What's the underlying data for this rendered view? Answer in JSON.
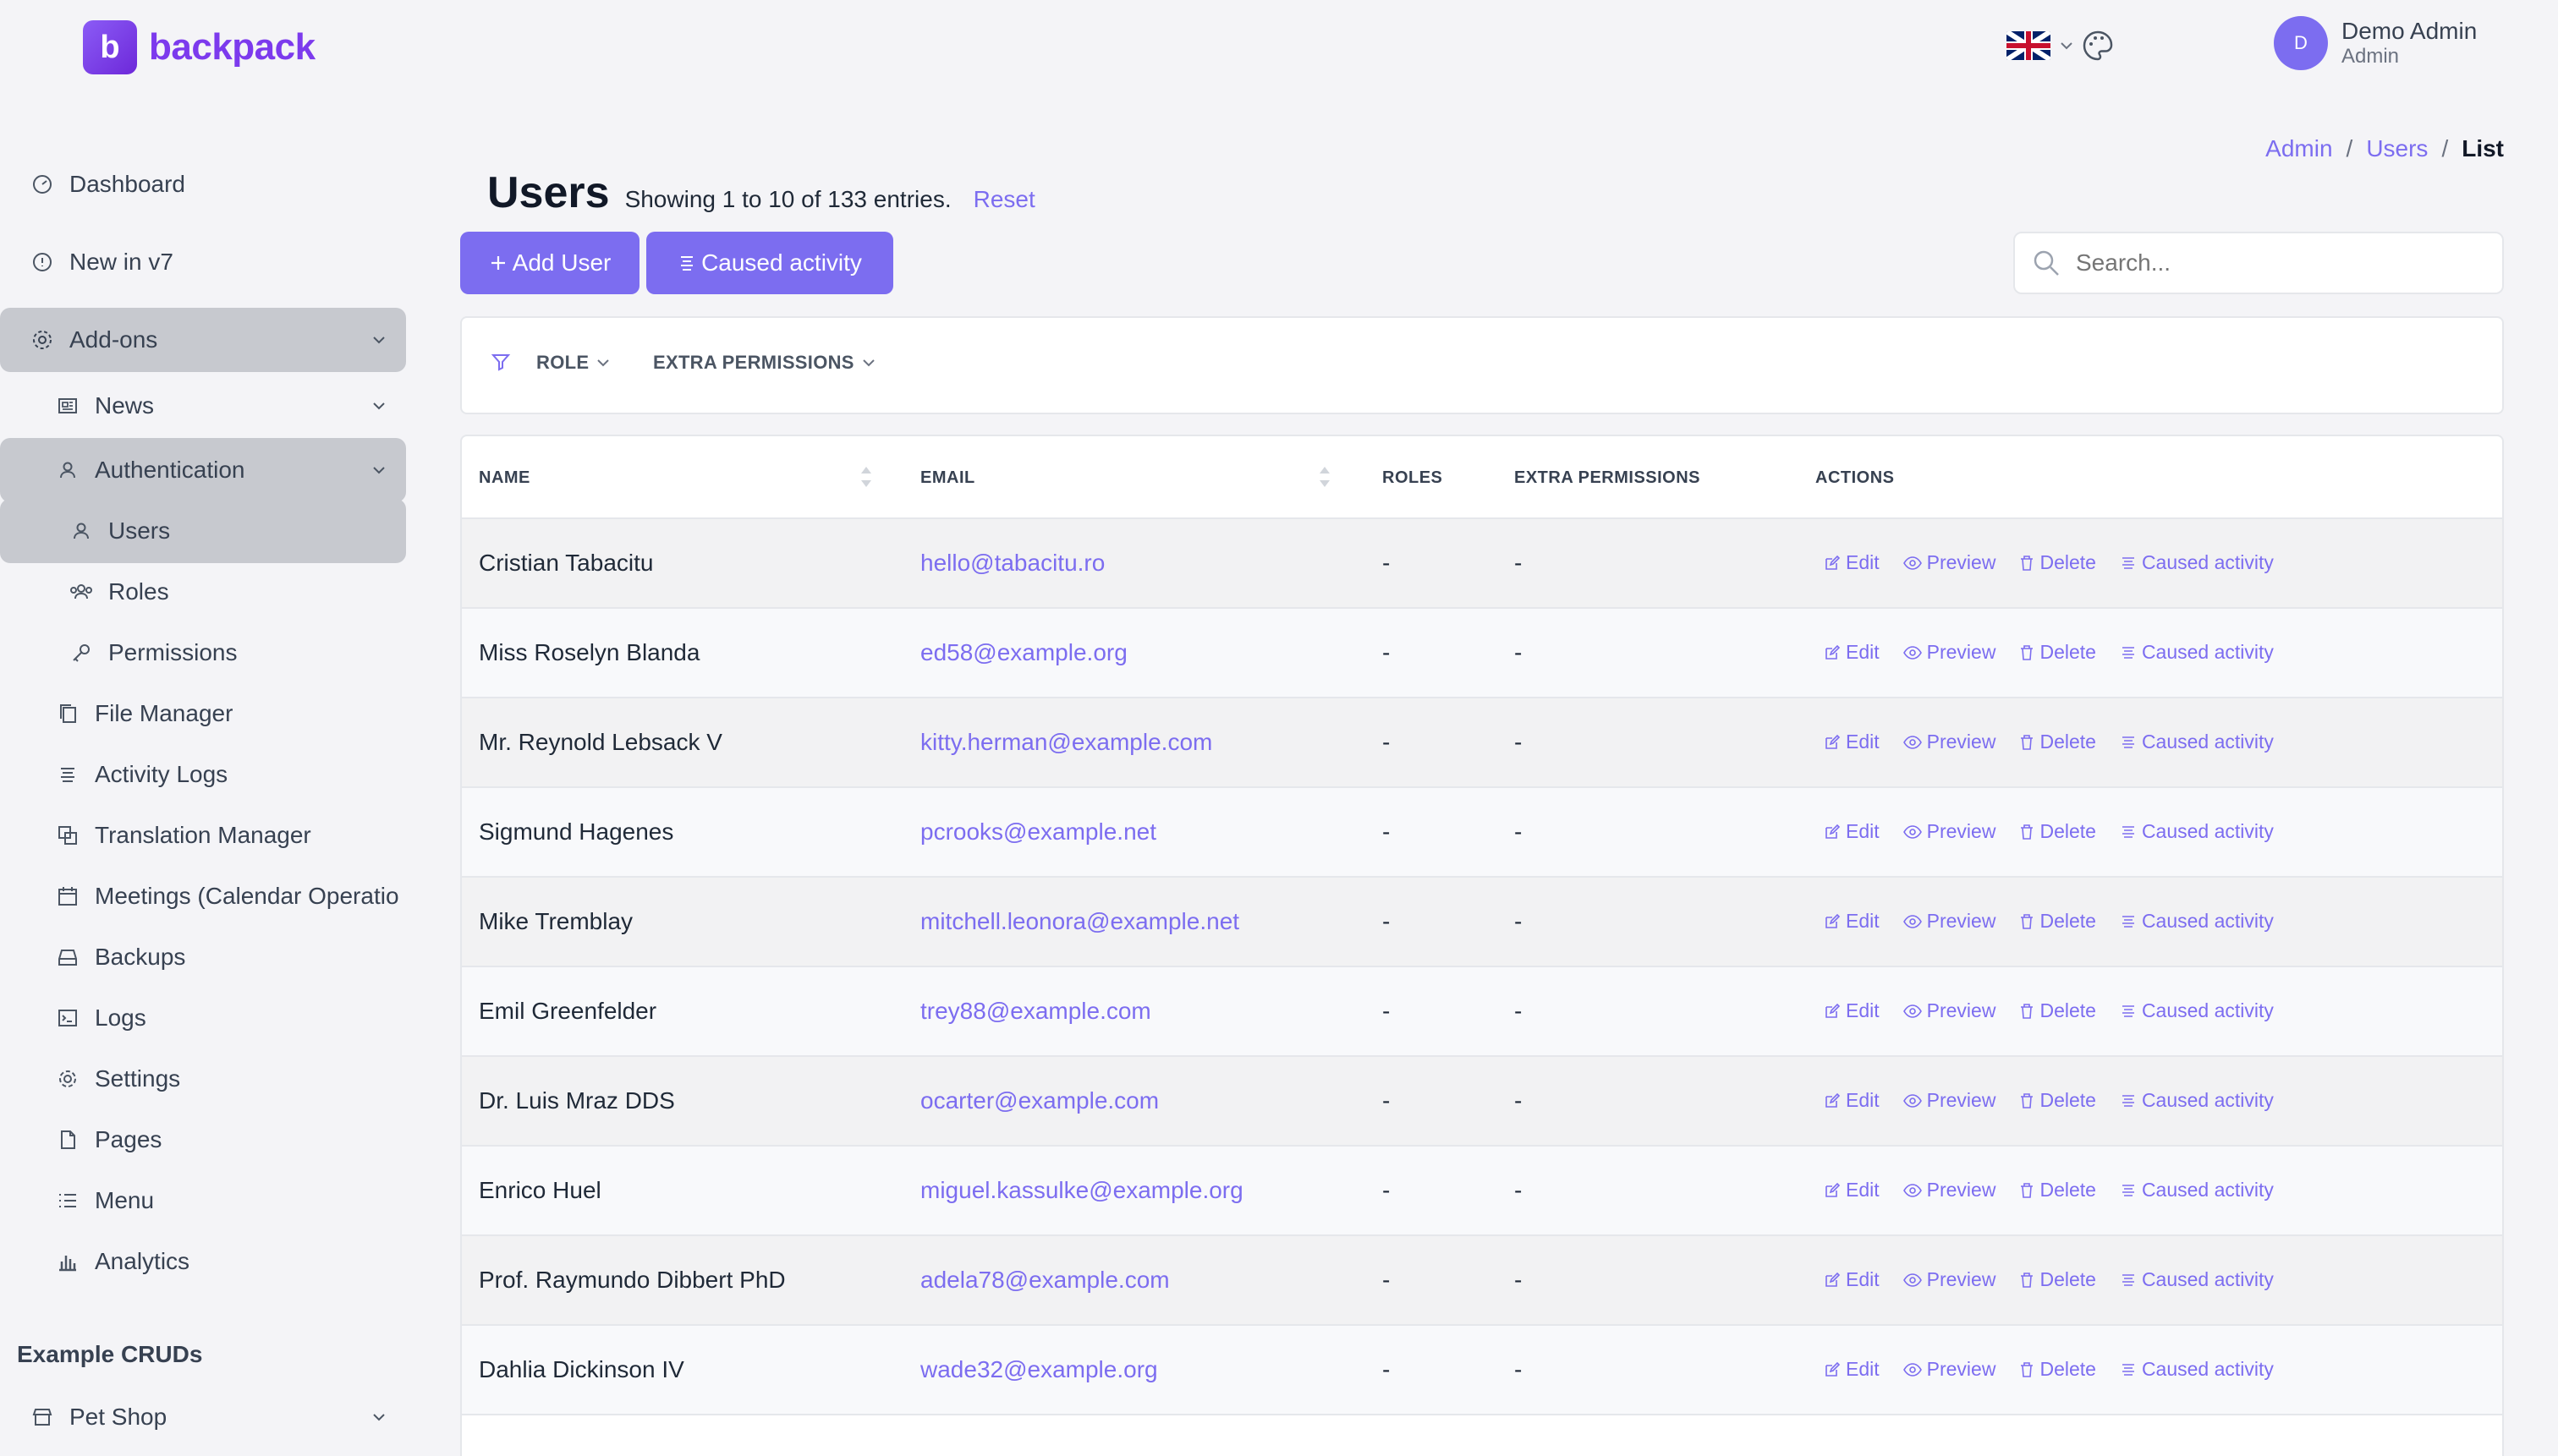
{
  "brand": {
    "name": "backpack",
    "logo_letter": "b"
  },
  "header": {
    "icons": [
      "monitor-icon",
      "palette-icon"
    ],
    "language": "en-GB",
    "user": {
      "initial": "D",
      "name": "Demo Admin",
      "role": "Admin"
    }
  },
  "sidebar": {
    "items": [
      {
        "label": "Dashboard",
        "icon": "gauge-icon"
      },
      {
        "label": "New in v7",
        "icon": "info-icon"
      },
      {
        "label": "Add-ons",
        "icon": "puzzle-icon"
      },
      {
        "label": "News",
        "icon": "newspaper-icon"
      },
      {
        "label": "Authentication",
        "icon": "user-icon"
      },
      {
        "label": "Users",
        "icon": "user-icon"
      },
      {
        "label": "Roles",
        "icon": "users-icon"
      },
      {
        "label": "Permissions",
        "icon": "key-icon"
      },
      {
        "label": "File Manager",
        "icon": "files-icon"
      },
      {
        "label": "Activity Logs",
        "icon": "stack-icon"
      },
      {
        "label": "Translation Manager",
        "icon": "language-icon"
      },
      {
        "label": "Meetings (Calendar Operatio",
        "icon": "calendar-icon"
      },
      {
        "label": "Backups",
        "icon": "drive-icon"
      },
      {
        "label": "Logs",
        "icon": "terminal-icon"
      },
      {
        "label": "Settings",
        "icon": "gear-icon"
      },
      {
        "label": "Pages",
        "icon": "page-icon"
      },
      {
        "label": "Menu",
        "icon": "list-icon"
      },
      {
        "label": "Analytics",
        "icon": "chart-icon"
      }
    ],
    "section_title": "Example CRUDs",
    "section_items": [
      {
        "label": "Pet Shop",
        "icon": "store-icon"
      }
    ]
  },
  "breadcrumb": {
    "admin": "Admin",
    "users": "Users",
    "current": "List",
    "sep": "/"
  },
  "page": {
    "title": "Users",
    "subtitle": "Showing 1 to 10 of 133 entries.",
    "reset": "Reset",
    "add_button": "Add User",
    "caused_button": "Caused activity"
  },
  "search": {
    "placeholder": "Search..."
  },
  "filters": {
    "role": "ROLE",
    "extra": "EXTRA PERMISSIONS"
  },
  "table": {
    "headers": {
      "name": "NAME",
      "email": "EMAIL",
      "roles": "ROLES",
      "extra": "EXTRA PERMISSIONS",
      "actions": "ACTIONS"
    },
    "action_labels": {
      "edit": "Edit",
      "preview": "Preview",
      "delete": "Delete",
      "caused": "Caused activity"
    },
    "rows": [
      {
        "name": "Cristian Tabacitu",
        "email": "hello@tabacitu.ro",
        "roles": "-",
        "extra": "-"
      },
      {
        "name": "Miss Roselyn Blanda",
        "email": "ed58@example.org",
        "roles": "-",
        "extra": "-"
      },
      {
        "name": "Mr. Reynold Lebsack V",
        "email": "kitty.herman@example.com",
        "roles": "-",
        "extra": "-"
      },
      {
        "name": "Sigmund Hagenes",
        "email": "pcrooks@example.net",
        "roles": "-",
        "extra": "-"
      },
      {
        "name": "Mike Tremblay",
        "email": "mitchell.leonora@example.net",
        "roles": "-",
        "extra": "-"
      },
      {
        "name": "Emil Greenfelder",
        "email": "trey88@example.com",
        "roles": "-",
        "extra": "-"
      },
      {
        "name": "Dr. Luis Mraz DDS",
        "email": "ocarter@example.com",
        "roles": "-",
        "extra": "-"
      },
      {
        "name": "Enrico Huel",
        "email": "miguel.kassulke@example.org",
        "roles": "-",
        "extra": "-"
      },
      {
        "name": "Prof. Raymundo Dibbert PhD",
        "email": "adela78@example.com",
        "roles": "-",
        "extra": "-"
      },
      {
        "name": "Dahlia Dickinson IV",
        "email": "wade32@example.org",
        "roles": "-",
        "extra": "-"
      }
    ]
  },
  "colors": {
    "accent": "#7c6df0",
    "active_nav": "#c7c9cf",
    "background": "#f4f4f7"
  }
}
